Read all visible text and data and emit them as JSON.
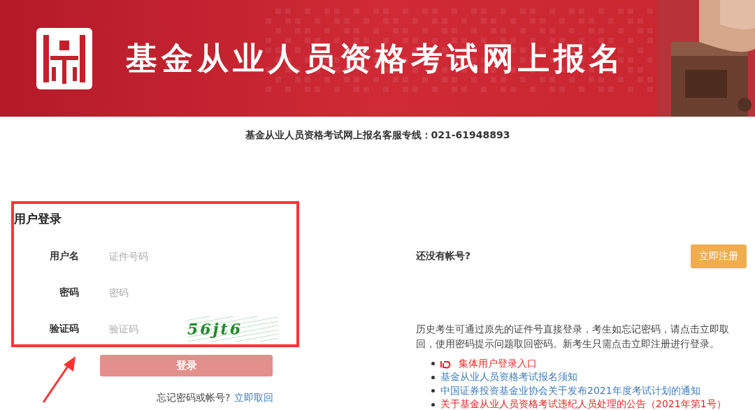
{
  "banner": {
    "title": "基金从业人员资格考试网上报名"
  },
  "hotline": "基金从业人员资格考试网上报名客服专线：021-61948893",
  "login": {
    "title": "用户登录",
    "fields": [
      {
        "label": "用户名",
        "placeholder": "证件号码",
        "kind": "text"
      },
      {
        "label": "密码",
        "placeholder": "密码",
        "kind": "password"
      },
      {
        "label": "验证码",
        "placeholder": "验证码",
        "kind": "captcha",
        "captcha": "56jt6"
      }
    ],
    "submit": "登录",
    "forgot": "忘记密码或帐号?",
    "forgot_link": "立即取回"
  },
  "register": {
    "prompt": "还没有帐号?",
    "button": "立即注册"
  },
  "notice": "历史考生可通过原先的证件号直接登录，考生如忘记密码，请点击立即取回，使用密码提示问题取回密码。新考生只需点击立即注册进行登录。",
  "links": [
    {
      "text": "集体用户登录入口",
      "color": "#ee2222",
      "kind": "featured"
    },
    {
      "text": "基金从业人员资格考试报名须知",
      "color": "#3a7bbf",
      "kind": "plain"
    },
    {
      "text": "中国证券投资基金业协会关于发布2021年度考试计划的通知",
      "color": "#3a7bbf",
      "kind": "plain"
    },
    {
      "text": "关于基金从业人员资格考试违纪人员处理的公告（2021年第1号）",
      "color": "#ee2222",
      "kind": "plain"
    }
  ]
}
